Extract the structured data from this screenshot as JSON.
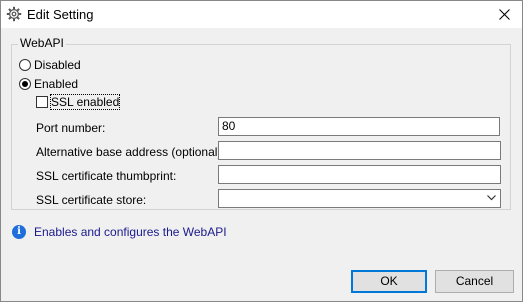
{
  "window": {
    "title": "Edit Setting"
  },
  "icons": {
    "title": "gear-icon",
    "close": "close-icon",
    "info": "info-icon",
    "dropdown": "chevron-down-icon"
  },
  "group": {
    "legend": "WebAPI"
  },
  "mode": {
    "options": [
      {
        "label": "Disabled",
        "checked": false
      },
      {
        "label": "Enabled",
        "checked": true
      }
    ]
  },
  "ssl_enabled": {
    "label": "SSL enabled",
    "checked": false
  },
  "fields": {
    "port": {
      "label": "Port number:",
      "value": "80"
    },
    "alt_base": {
      "label": "Alternative base address (optional):",
      "value": ""
    },
    "thumbprint": {
      "label": "SSL certificate thumbprint:",
      "value": ""
    },
    "store": {
      "label": "SSL certificate store:",
      "value": ""
    }
  },
  "info": {
    "symbol": "i",
    "text": "Enables and configures the WebAPI"
  },
  "buttons": {
    "ok": "OK",
    "cancel": "Cancel"
  },
  "colors": {
    "accent": "#0078d7",
    "info_text": "#1a1a8c",
    "info_icon": "#1e6fd9"
  }
}
